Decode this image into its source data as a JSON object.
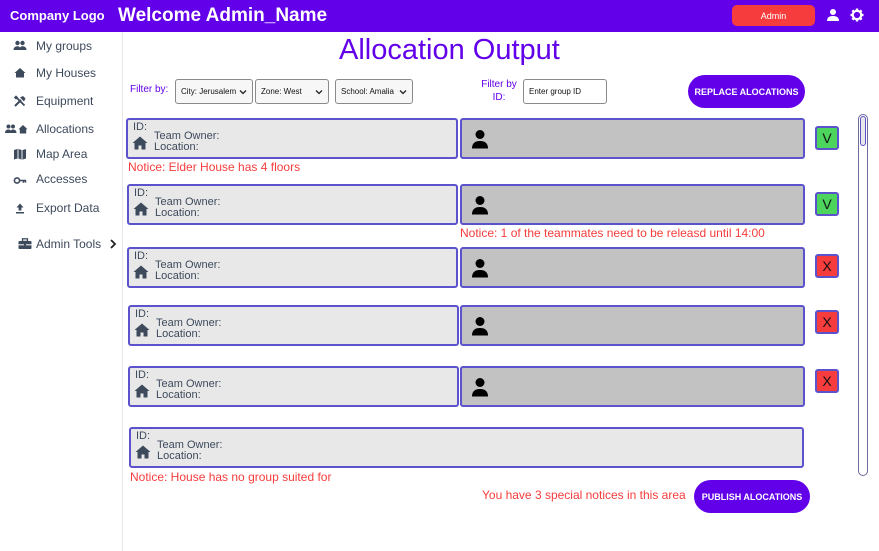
{
  "header": {
    "logo": "Company Logo",
    "welcome": "Welcome Admin_Name",
    "admin_button": "Admin",
    "icons": [
      "person-icon",
      "gear-icon"
    ]
  },
  "sidebar": {
    "items": [
      {
        "label": "My groups",
        "icon": "group-icon"
      },
      {
        "label": "My Houses",
        "icon": "house-icon"
      },
      {
        "label": "Equipment",
        "icon": "tools-icon"
      },
      {
        "label": "Allocations",
        "icon": "allocation-icon"
      },
      {
        "label": "Map Area",
        "icon": "map-icon"
      },
      {
        "label": "Accesses",
        "icon": "key-icon"
      },
      {
        "label": "Export Data",
        "icon": "upload-icon"
      },
      {
        "label": "Admin Tools",
        "icon": "toolbox-icon"
      }
    ]
  },
  "main": {
    "title": "Allocation Output",
    "filter_label": "Filter by:",
    "filters": [
      {
        "value": "City: Jerusalem"
      },
      {
        "value": "Zone: West"
      },
      {
        "value": "School: Amalia"
      }
    ],
    "filter_id_label": "Filter by ID:",
    "group_id_placeholder": "Enter group ID",
    "replace_button": "REPLACE ALOCATIONS",
    "publish_button": "PUBLISH ALOCATIONS",
    "summary_notice": "You have 3 special notices in this area"
  },
  "rows": [
    {
      "id": "ID:",
      "owner": "Team Owner:",
      "location": "Location:",
      "has_group": true,
      "status": "V",
      "notice": "Notice: Elder House has 4 floors"
    },
    {
      "id": "ID:",
      "owner": "Team Owner:",
      "location": "Location:",
      "has_group": true,
      "status": "V",
      "notice": "Notice: 1 of the teammates need to be releasd until 14:00"
    },
    {
      "id": "ID:",
      "owner": "Team Owner:",
      "location": "Location:",
      "has_group": true,
      "status": "X",
      "notice": ""
    },
    {
      "id": "ID:",
      "owner": "Team Owner:",
      "location": "Location:",
      "has_group": true,
      "status": "X",
      "notice": ""
    },
    {
      "id": "ID:",
      "owner": "Team Owner:",
      "location": "Location:",
      "has_group": true,
      "status": "X",
      "notice": ""
    },
    {
      "id": "ID:",
      "owner": "Team Owner:",
      "location": "Location:",
      "has_group": false,
      "status": "",
      "notice": "Notice: House has no group suited for"
    }
  ],
  "colors": {
    "primary": "#6200ea",
    "danger": "#f63c3c",
    "ok": "#4cd45c",
    "row_border": "#5b52cc",
    "row_left_bg": "#e8e8e8",
    "row_right_bg": "#c2c2c2"
  }
}
